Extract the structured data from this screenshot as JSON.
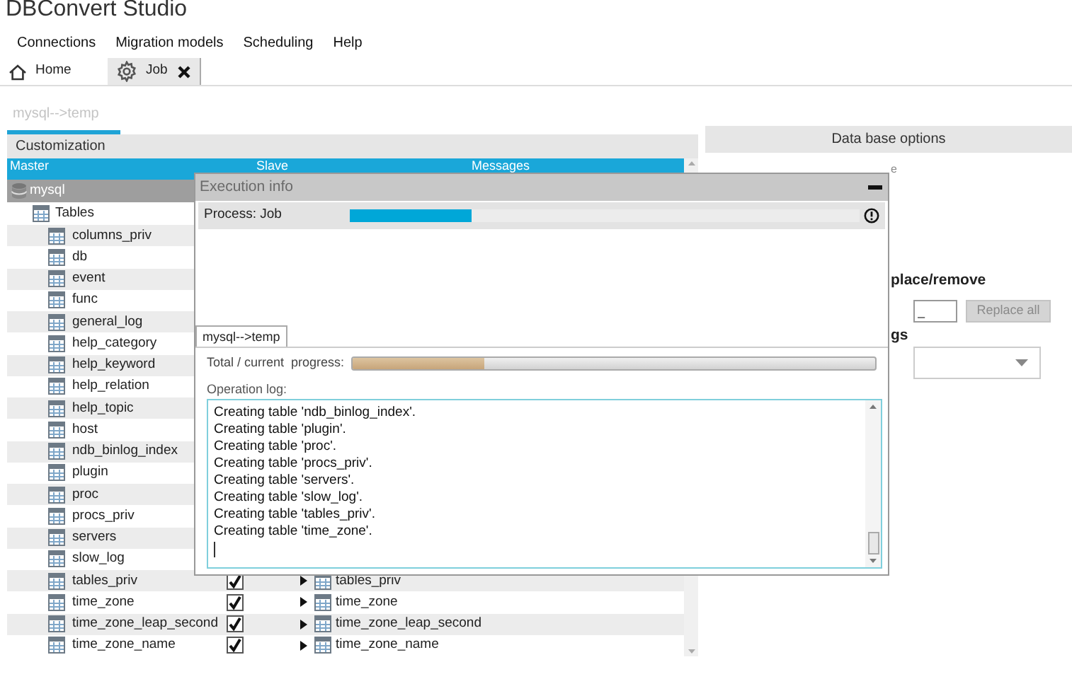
{
  "app_title": "DBConvert Studio",
  "menu": [
    "Connections",
    "Migration models",
    "Scheduling",
    "Help"
  ],
  "tabs": [
    {
      "label": "Home",
      "kind": "home",
      "selected": false,
      "closable": false
    },
    {
      "label": "Job",
      "kind": "job",
      "selected": true,
      "closable": true
    }
  ],
  "connection_label": "mysql-->temp",
  "customization": {
    "title": "Customization",
    "columns": [
      "Master",
      "Slave",
      "Messages"
    ],
    "database": "mysql",
    "folder": "Tables",
    "tables": [
      {
        "name": "columns_priv"
      },
      {
        "name": "db"
      },
      {
        "name": "event"
      },
      {
        "name": "func"
      },
      {
        "name": "general_log"
      },
      {
        "name": "help_category"
      },
      {
        "name": "help_keyword"
      },
      {
        "name": "help_relation"
      },
      {
        "name": "help_topic"
      },
      {
        "name": "host"
      },
      {
        "name": "ndb_binlog_index"
      },
      {
        "name": "plugin"
      },
      {
        "name": "proc"
      },
      {
        "name": "procs_priv"
      },
      {
        "name": "servers"
      },
      {
        "name": "slow_log"
      },
      {
        "name": "tables_priv",
        "slave": {
          "checked": true,
          "name": "tables_priv"
        }
      },
      {
        "name": "time_zone",
        "slave": {
          "checked": true,
          "name": "time_zone"
        }
      },
      {
        "name": "time_zone_leap_second",
        "slave": {
          "checked": true,
          "name": "time_zone_leap_second"
        }
      },
      {
        "name": "time_zone_name",
        "slave": {
          "checked": true,
          "name": "time_zone_name"
        }
      }
    ]
  },
  "database_options": {
    "title": "Data base options",
    "option_fragment": "e",
    "replace_heading": "place/remove",
    "replace_value": "_",
    "replace_button": {
      "label": "Replace all",
      "disabled": true
    },
    "settings_heading": "gs"
  },
  "execution_info": {
    "title": "Execution info",
    "process_label": "Process: Job",
    "process": {
      "level": 0.24
    },
    "job_tab": "mysql-->temp",
    "progress_label": "Total / current  progress:",
    "progress": {
      "level": 0.25
    },
    "log_label": "Operation log:",
    "log": [
      "Creating table 'ndb_binlog_index'.",
      "Creating table 'plugin'.",
      "Creating table 'proc'.",
      "Creating table 'procs_priv'.",
      "Creating table 'servers'.",
      "Creating table 'slow_log'.",
      "Creating table 'tables_priv'.",
      "Creating table 'time_zone'."
    ]
  }
}
